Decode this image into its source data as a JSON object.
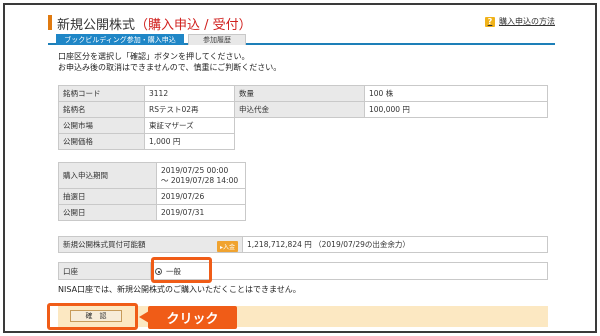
{
  "header": {
    "title_prefix": "新規公開株式",
    "title_accent": "（購入申込 / 受付）",
    "help_icon_glyph": "?",
    "help_link": "購入申込の方法"
  },
  "tabs": [
    {
      "label": "ブックビルディング参加・購入申込",
      "active": true
    },
    {
      "label": "参加履歴",
      "active": false
    }
  ],
  "instructions": {
    "line1": "口座区分を選択し「確認」ボタンを押してください。",
    "line2": "お申込み後の取消はできませんので、慎重にご判断ください。"
  },
  "details": {
    "code_label": "銘柄コード",
    "code_value": "3112",
    "qty_label": "数量",
    "qty_value": "100 株",
    "name_label": "銘柄名",
    "name_value": "RSテスト02再",
    "amount_label": "申込代金",
    "amount_value": "100,000 円",
    "market_label": "公開市場",
    "market_value": "東証マザーズ",
    "price_label": "公開価格",
    "price_value": "1,000 円"
  },
  "schedule": {
    "period_label": "購入申込期間",
    "period_start": "2019/07/25 00:00",
    "period_end": "～ 2019/07/28 14:00",
    "lottery_label": "抽選日",
    "lottery_value": "2019/07/26",
    "listing_label": "公開日",
    "listing_value": "2019/07/31"
  },
  "funds": {
    "label": "新規公開株式買付可能額",
    "badge": "入金",
    "value": "1,218,712,824 円 （2019/07/29の出金余力）"
  },
  "account": {
    "label": "口座",
    "option": "一般"
  },
  "nisa_note": "NISA口座では、新規公開株式のご購入いただくことはできません。",
  "confirm_button": "確　認",
  "callout": "クリック",
  "colors": {
    "accent": "#f05c17",
    "tab_blue": "#1f86c6",
    "title_red": "#d0201e"
  }
}
